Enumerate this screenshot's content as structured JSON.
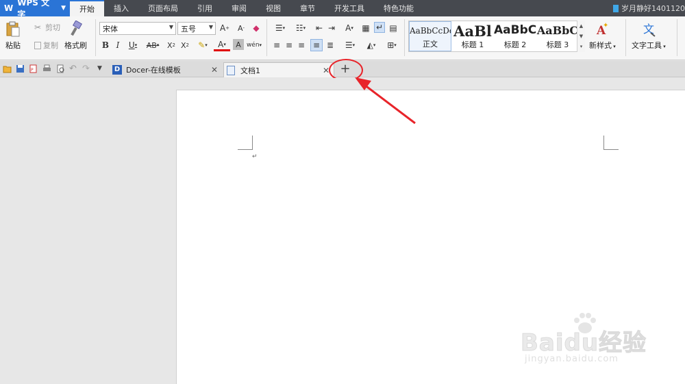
{
  "app": {
    "name": "WPS 文字",
    "logo": "W"
  },
  "menu": [
    "开始",
    "插入",
    "页面布局",
    "引用",
    "审阅",
    "视图",
    "章节",
    "开发工具",
    "特色功能"
  ],
  "active_menu_index": 0,
  "user": {
    "name": "岁月静好1401120"
  },
  "ribbon": {
    "clipboard": {
      "paste": "粘贴",
      "cut": "剪切",
      "copy": "复制",
      "format_painter": "格式刷"
    },
    "font": {
      "name": "宋体",
      "size": "五号"
    },
    "styles": [
      {
        "sample": "AaBbCcDd",
        "label": "正文"
      },
      {
        "sample": "AaBl",
        "label": "标题 1"
      },
      {
        "sample": "AaBbC",
        "label": "标题 2"
      },
      {
        "sample": "AaBbC",
        "label": "标题 3"
      }
    ],
    "new_style": "新样式",
    "text_tools": "文字工具"
  },
  "tabs": [
    {
      "title": "Docer-在线模板"
    },
    {
      "title": "文档1"
    }
  ],
  "watermark": {
    "brand": "Baidu经验",
    "url": "jingyan.baidu.com"
  },
  "colors": {
    "accent": "#2a74d6",
    "menubar": "#46494f",
    "annotation": "#e8242a"
  }
}
